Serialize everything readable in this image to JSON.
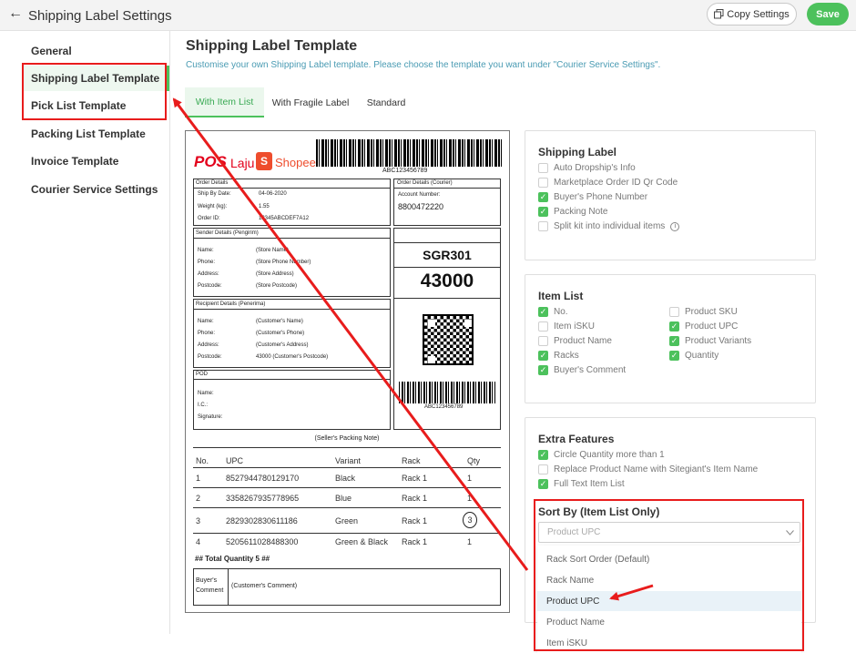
{
  "header": {
    "title": "Shipping Label Settings",
    "copy_label": "Copy Settings",
    "save_label": "Save"
  },
  "sidebar": {
    "items": [
      {
        "label": "General"
      },
      {
        "label": "Shipping Label Template"
      },
      {
        "label": "Pick List Template"
      },
      {
        "label": "Packing List Template"
      },
      {
        "label": "Invoice Template"
      },
      {
        "label": "Courier Service Settings"
      }
    ]
  },
  "main": {
    "title": "Shipping Label Template",
    "subtitle": "Customise your own Shipping Label template. Please choose the template you want under \"Courier Service Settings\".",
    "tabs": [
      {
        "label": "With Item List",
        "active": true
      },
      {
        "label": "With Fragile Label",
        "active": false
      },
      {
        "label": "Standard",
        "active": false
      }
    ]
  },
  "preview": {
    "brand_pos": "POS",
    "brand_laju": "Laju",
    "brand_shopee": "Shopee",
    "tracking_number": "ABC123456789",
    "order_details": {
      "heading": "Order Details",
      "ship_by_label": "Ship By Date:",
      "ship_by_value": "04-06-2020",
      "weight_label": "Weight (kg):",
      "weight_value": "1.55",
      "order_id_label": "Order ID:",
      "order_id_value": "12345ABCDEF7A12"
    },
    "courier": {
      "heading": "Order Details (Courier)",
      "account_label": "Account Number:",
      "account_value": "8800472220"
    },
    "sender": {
      "heading": "Sender Details (Pengirim)",
      "name_label": "Name:",
      "name_value": "(Store Name)",
      "phone_label": "Phone:",
      "phone_value": "(Store Phone Number)",
      "address_label": "Address:",
      "address_value": "(Store Address)",
      "postcode_label": "Postcode:",
      "postcode_value": "(Store Postcode)"
    },
    "recipient": {
      "heading": "Recipient Details (Penerima)",
      "name_label": "Name:",
      "name_value": "(Customer's Name)",
      "phone_label": "Phone:",
      "phone_value": "(Customer's Phone)",
      "address_label": "Address:",
      "address_value": "(Customer's Address)",
      "postcode_label": "Postcode:",
      "postcode_value": "43000 (Customer's Postcode)"
    },
    "pod": {
      "heading": "POD",
      "name_label": "Name:",
      "ic_label": "I.C.:",
      "signature_label": "Signature:"
    },
    "route_code": "SGR301",
    "postcode_big": "43000",
    "packing_note": "(Seller's Packing Note)",
    "table": {
      "headers": [
        "No.",
        "UPC",
        "Variant",
        "Rack",
        "Qty"
      ],
      "rows": [
        [
          "1",
          "8527944780129170",
          "Black",
          "Rack 1",
          "1"
        ],
        [
          "2",
          "3358267935778965",
          "Blue",
          "Rack 1",
          "1"
        ],
        [
          "3",
          "2829302830611186",
          "Green",
          "Rack 1",
          "3"
        ],
        [
          "4",
          "5205611028488300",
          "Green & Black",
          "Rack 1",
          "1"
        ]
      ],
      "total": "## Total Quantity 5 ##"
    },
    "buyer_comment_label1": "Buyer's",
    "buyer_comment_label2": "Comment",
    "buyer_comment_value": "(Customer's Comment)"
  },
  "shipping_label_panel": {
    "title": "Shipping Label",
    "options": [
      {
        "label": "Auto Dropship's Info",
        "checked": false
      },
      {
        "label": "Marketplace Order ID Qr Code",
        "checked": false
      },
      {
        "label": "Buyer's Phone Number",
        "checked": true
      },
      {
        "label": "Packing Note",
        "checked": true
      },
      {
        "label": "Split kit into individual items",
        "checked": false
      }
    ]
  },
  "item_list_panel": {
    "title": "Item List",
    "left": [
      {
        "label": "No.",
        "checked": true
      },
      {
        "label": "Item iSKU",
        "checked": false
      },
      {
        "label": "Product Name",
        "checked": false
      },
      {
        "label": "Racks",
        "checked": true
      },
      {
        "label": "Buyer's Comment",
        "checked": true
      }
    ],
    "right": [
      {
        "label": "Product SKU",
        "checked": false
      },
      {
        "label": "Product UPC",
        "checked": true
      },
      {
        "label": "Product Variants",
        "checked": true
      },
      {
        "label": "Quantity",
        "checked": true
      }
    ]
  },
  "extra_panel": {
    "title": "Extra Features",
    "options": [
      {
        "label": "Circle Quantity more than 1",
        "checked": true
      },
      {
        "label": "Replace Product Name with Sitegiant's Item Name",
        "checked": false
      },
      {
        "label": "Full Text Item List",
        "checked": true
      }
    ],
    "sort_label": "Sort By (Item List Only)",
    "sort_placeholder": "Product UPC",
    "sort_options": [
      "Rack Sort Order (Default)",
      "Rack Name",
      "Product UPC",
      "Product Name",
      "Item iSKU"
    ],
    "sort_selected_index": 2
  },
  "colors": {
    "accent": "#4cc15c",
    "annotation": "#e81c1c",
    "shopee": "#ee4d2d",
    "pos": "#e3001b"
  }
}
